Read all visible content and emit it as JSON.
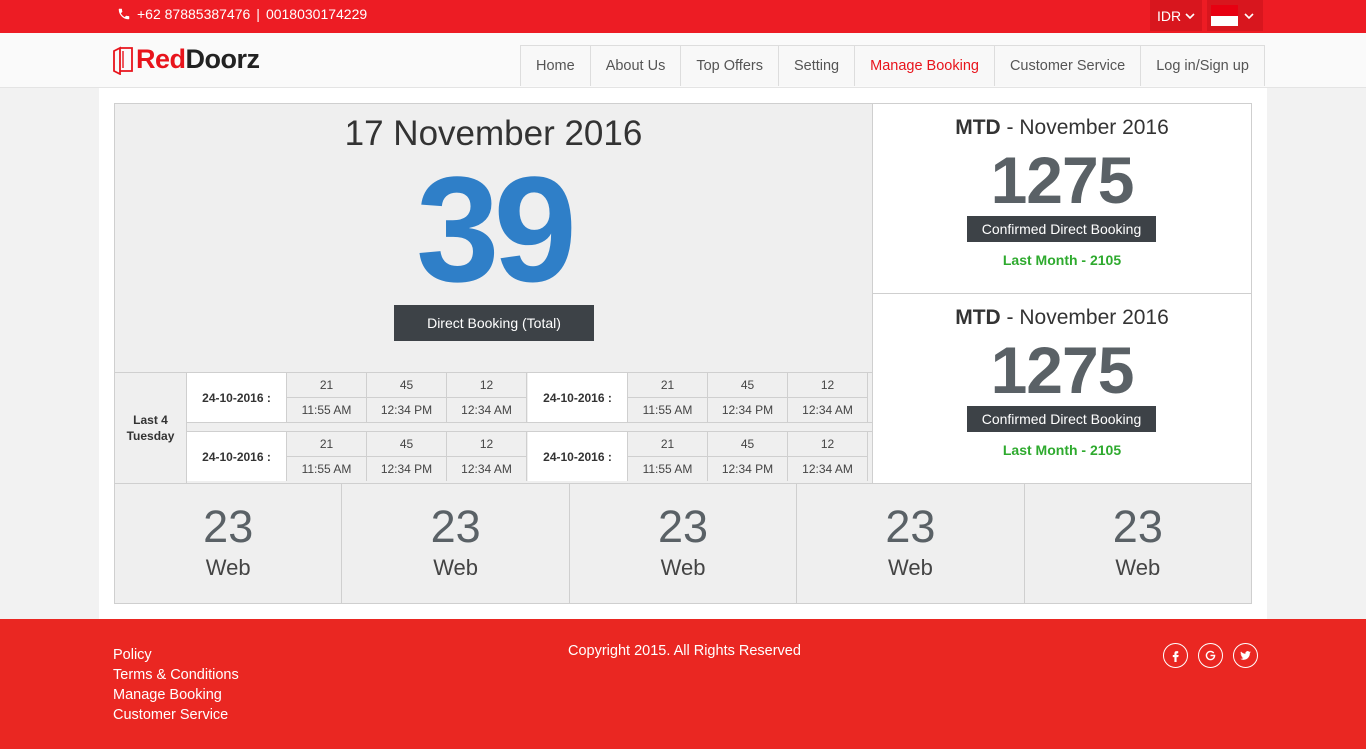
{
  "topbar": {
    "phone": "+62 87885387476",
    "separator": "|",
    "alt_phone": "0018030174229",
    "currency": "IDR",
    "flag": "indonesia-flag",
    "colors": {
      "brand_red": "#ed1c24"
    }
  },
  "header": {
    "logo_red": "Red",
    "logo_dark": "Doorz",
    "nav": [
      {
        "label": "Home",
        "active": false
      },
      {
        "label": "About Us",
        "active": false
      },
      {
        "label": "Top Offers",
        "active": false
      },
      {
        "label": "Setting",
        "active": false
      },
      {
        "label": "Manage Booking",
        "active": true
      },
      {
        "label": "Customer Service",
        "active": false
      },
      {
        "label": "Log in/Sign up",
        "active": false
      }
    ]
  },
  "dashboard": {
    "date": "17 November 2016",
    "total": "39",
    "total_label": "Direct Booking (Total)",
    "total_color": "#2f7fc8",
    "mtd": [
      {
        "prefix": "MTD",
        "dash": " - ",
        "month": "November 2016",
        "value": "1275",
        "badge": "Confirmed Direct Booking",
        "last_month": "Last Month - 2105"
      },
      {
        "prefix": "MTD",
        "dash": " - ",
        "month": "November 2016",
        "value": "1275",
        "badge": "Confirmed Direct Booking",
        "last_month": "Last Month - 2105"
      }
    ],
    "last4_label": "Last 4 Tuesday",
    "rows": [
      [
        {
          "date": "24-10-2016 :",
          "cols": [
            {
              "count": "21",
              "time": "11:55 AM"
            },
            {
              "count": "45",
              "time": "12:34 PM"
            },
            {
              "count": "12",
              "time": "12:34 AM"
            }
          ]
        },
        {
          "date": "24-10-2016 :",
          "cols": [
            {
              "count": "21",
              "time": "11:55 AM"
            },
            {
              "count": "45",
              "time": "12:34 PM"
            },
            {
              "count": "12",
              "time": "12:34 AM"
            }
          ]
        }
      ],
      [
        {
          "date": "24-10-2016 :",
          "cols": [
            {
              "count": "21",
              "time": "11:55 AM"
            },
            {
              "count": "45",
              "time": "12:34 PM"
            },
            {
              "count": "12",
              "time": "12:34 AM"
            }
          ]
        },
        {
          "date": "24-10-2016 :",
          "cols": [
            {
              "count": "21",
              "time": "11:55 AM"
            },
            {
              "count": "45",
              "time": "12:34 PM"
            },
            {
              "count": "12",
              "time": "12:34 AM"
            }
          ]
        }
      ]
    ],
    "tiles": [
      {
        "value": "23",
        "label": "Web"
      },
      {
        "value": "23",
        "label": "Web"
      },
      {
        "value": "23",
        "label": "Web"
      },
      {
        "value": "23",
        "label": "Web"
      },
      {
        "value": "23",
        "label": "Web"
      }
    ]
  },
  "footer": {
    "links": [
      "Policy",
      "Terms & Conditions",
      "Manage Booking",
      "Customer Service"
    ],
    "copyright": "Copyright 2015. All Rights Reserved",
    "social": [
      "facebook-icon",
      "google-plus-icon",
      "twitter-icon"
    ]
  }
}
